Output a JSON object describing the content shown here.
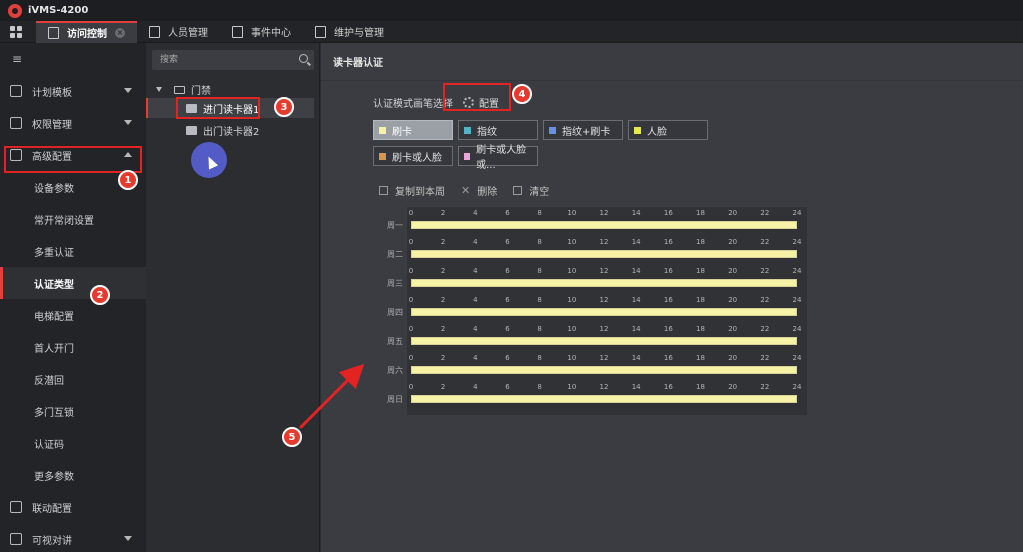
{
  "app": {
    "title": "iVMS-4200"
  },
  "tabs": [
    {
      "label": "访问控制",
      "active": true,
      "closable": true
    },
    {
      "label": "人员管理"
    },
    {
      "label": "事件中心"
    },
    {
      "label": "维护与管理"
    }
  ],
  "nav": {
    "items": [
      {
        "label": "计划模板",
        "expanded": false
      },
      {
        "label": "权限管理",
        "expanded": false
      },
      {
        "label": "高级配置",
        "expanded": true
      }
    ],
    "sub_items": [
      "设备参数",
      "常开常闭设置",
      "多重认证",
      "认证类型",
      "电梯配置",
      "首人开门",
      "反潜回",
      "多门互锁",
      "认证码",
      "更多参数"
    ],
    "active_sub": "认证类型",
    "bottom_items": [
      {
        "label": "联动配置"
      },
      {
        "label": "可视对讲",
        "expanded": false
      }
    ]
  },
  "tree": {
    "search_placeholder": "搜索",
    "root": "门禁",
    "nodes": [
      "进门读卡器1",
      "出门读卡器2"
    ],
    "selected": "进门读卡器1"
  },
  "content": {
    "title": "读卡器认证",
    "mode_label": "认证模式画笔选择",
    "config_label": "配置",
    "legend": [
      {
        "label": "刷卡",
        "color": "#f6f2a6",
        "selected": true
      },
      {
        "label": "指纹",
        "color": "#4fb6c9"
      },
      {
        "label": "指纹+刷卡",
        "color": "#6a8fe8"
      },
      {
        "label": "人脸",
        "color": "#e8e84a"
      },
      {
        "label": "刷卡或人脸",
        "color": "#d9964a"
      },
      {
        "label": "刷卡或人脸或...",
        "color": "#e8a6d8"
      }
    ],
    "toolbar": {
      "copy": "复制到本周",
      "delete": "删除",
      "clear": "清空"
    },
    "days": [
      "周一",
      "周二",
      "周三",
      "周四",
      "周五",
      "周六",
      "周日"
    ],
    "hours": [
      "0",
      "2",
      "4",
      "6",
      "8",
      "10",
      "12",
      "14",
      "16",
      "18",
      "20",
      "22",
      "24"
    ]
  },
  "annotations": [
    "1",
    "2",
    "3",
    "4",
    "5"
  ],
  "colors": {
    "accent": "#e0403a",
    "annotation": "#e32222"
  }
}
